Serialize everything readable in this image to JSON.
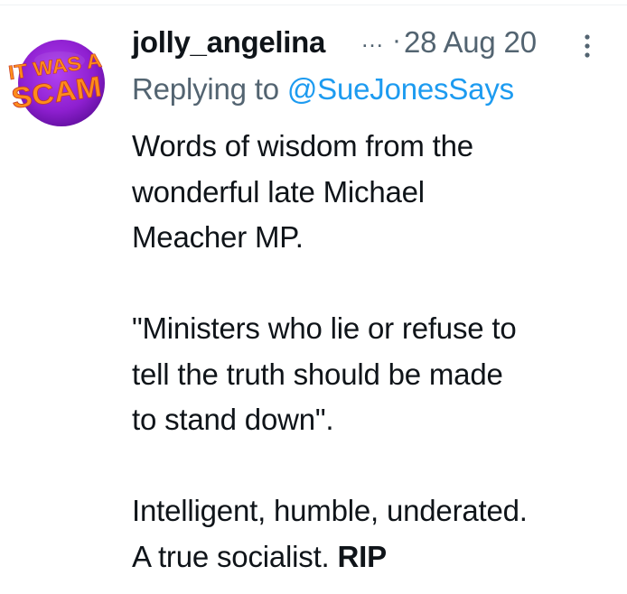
{
  "tweet": {
    "avatar_text": [
      "IT WAS A",
      "SCAM"
    ],
    "username": "jolly_angelina",
    "truncation": "…",
    "separator": "·",
    "timestamp": "28 Aug 20",
    "reply_prefix": "Replying to",
    "reply_handle": "@SueJonesSays",
    "lines": [
      "Words of wisdom from the",
      "wonderful late Michael",
      "Meacher MP.",
      "",
      "\"Ministers who lie or refuse to",
      "tell the truth should be made",
      "to stand down\".",
      "",
      "Intelligent, humble, underated.",
      "A true socialist."
    ],
    "closing_bold": "RIP"
  },
  "icons": {
    "more": "more-vertical-icon"
  },
  "colors": {
    "text": "#0f1419",
    "secondary": "#536471",
    "link": "#1d9bf0",
    "avatar_purple": "#8e1fd0",
    "avatar_orange": "#ff8c1a"
  }
}
